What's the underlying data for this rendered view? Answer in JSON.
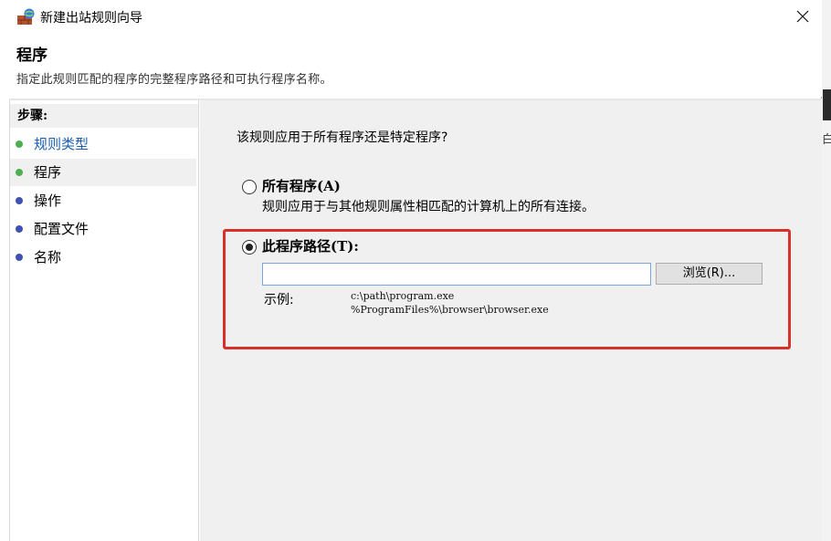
{
  "window": {
    "title": "新建出站规则向导",
    "app_icon": "firewall-wizard-icon",
    "close_icon": "close-icon"
  },
  "header": {
    "title": "程序",
    "description": "指定此规则匹配的程序的完整程序路径和可执行程序名称。"
  },
  "sidebar": {
    "heading": "步骤:",
    "items": [
      {
        "label": "规则类型",
        "state": "completed",
        "dot_color": "#4caf50",
        "text_color": "#1a5fb4"
      },
      {
        "label": "程序",
        "state": "current",
        "dot_color": "#4caf50",
        "text_color": "#000000"
      },
      {
        "label": "操作",
        "state": "pending",
        "dot_color": "#3f51b5",
        "text_color": "#000000"
      },
      {
        "label": "配置文件",
        "state": "pending",
        "dot_color": "#3f51b5",
        "text_color": "#000000"
      },
      {
        "label": "名称",
        "state": "pending",
        "dot_color": "#3f51b5",
        "text_color": "#000000"
      }
    ]
  },
  "content": {
    "question": "该规则应用于所有程序还是特定程序?",
    "all_programs": {
      "label": "所有程序(A)",
      "description": "规则应用于与其他规则属性相匹配的计算机上的所有连接。",
      "checked": false
    },
    "this_program": {
      "label": "此程序路径(T):",
      "checked": true,
      "path_value": "",
      "browse_label": "浏览(R)..."
    },
    "example": {
      "label": "示例:",
      "lines": [
        "c:\\path\\program.exe",
        "%ProgramFiles%\\browser\\browser.exe"
      ]
    }
  },
  "edge": {
    "partial_char": "白"
  },
  "colors": {
    "highlight_border": "#d8302a",
    "input_border": "#7aa7d8",
    "panel_bg": "#f0f0f0"
  }
}
